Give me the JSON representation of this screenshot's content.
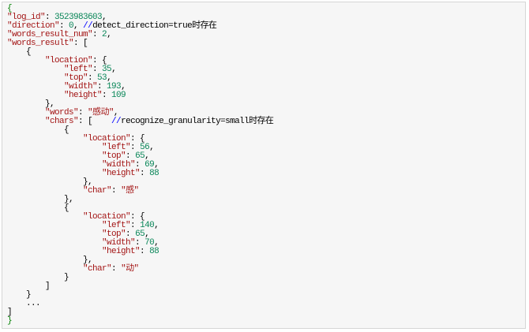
{
  "colors": {
    "key": "#a31515",
    "number": "#098658",
    "string": "#a31515",
    "comment_marker": "#0000ff",
    "outer_brace": "#008000",
    "background": "#f6f6f6",
    "border": "#d6d6d6"
  },
  "code": {
    "open_brace": "{",
    "log_id_key": "\"log_id\"",
    "log_id_value": "3523983603",
    "direction_key": "\"direction\"",
    "direction_value": "0",
    "direction_comment_marker": "//",
    "direction_comment": "detect_direction=true时存在",
    "words_result_num_key": "\"words_result_num\"",
    "words_result_num_value": "2",
    "words_result_key": "\"words_result\"",
    "location_key": "\"location\"",
    "left_key": "\"left\"",
    "top_key": "\"top\"",
    "width_key": "\"width\"",
    "height_key": "\"height\"",
    "loc_left": "35",
    "loc_top": "53",
    "loc_width": "193",
    "loc_height": "109",
    "words_key": "\"words\"",
    "words_value": "\"感动\"",
    "chars_key": "\"chars\"",
    "chars_comment_marker": "//",
    "chars_comment": "recognize_granularity=small时存在",
    "char_key": "\"char\"",
    "char1_left": "56",
    "char1_top": "65",
    "char1_width": "69",
    "char1_height": "88",
    "char1_value": "\"感\"",
    "char2_left": "140",
    "char2_top": "65",
    "char2_width": "70",
    "char2_height": "88",
    "char2_value": "\"动\"",
    "ellipsis": "...",
    "close_bracket": "]",
    "close_brace": "}"
  }
}
